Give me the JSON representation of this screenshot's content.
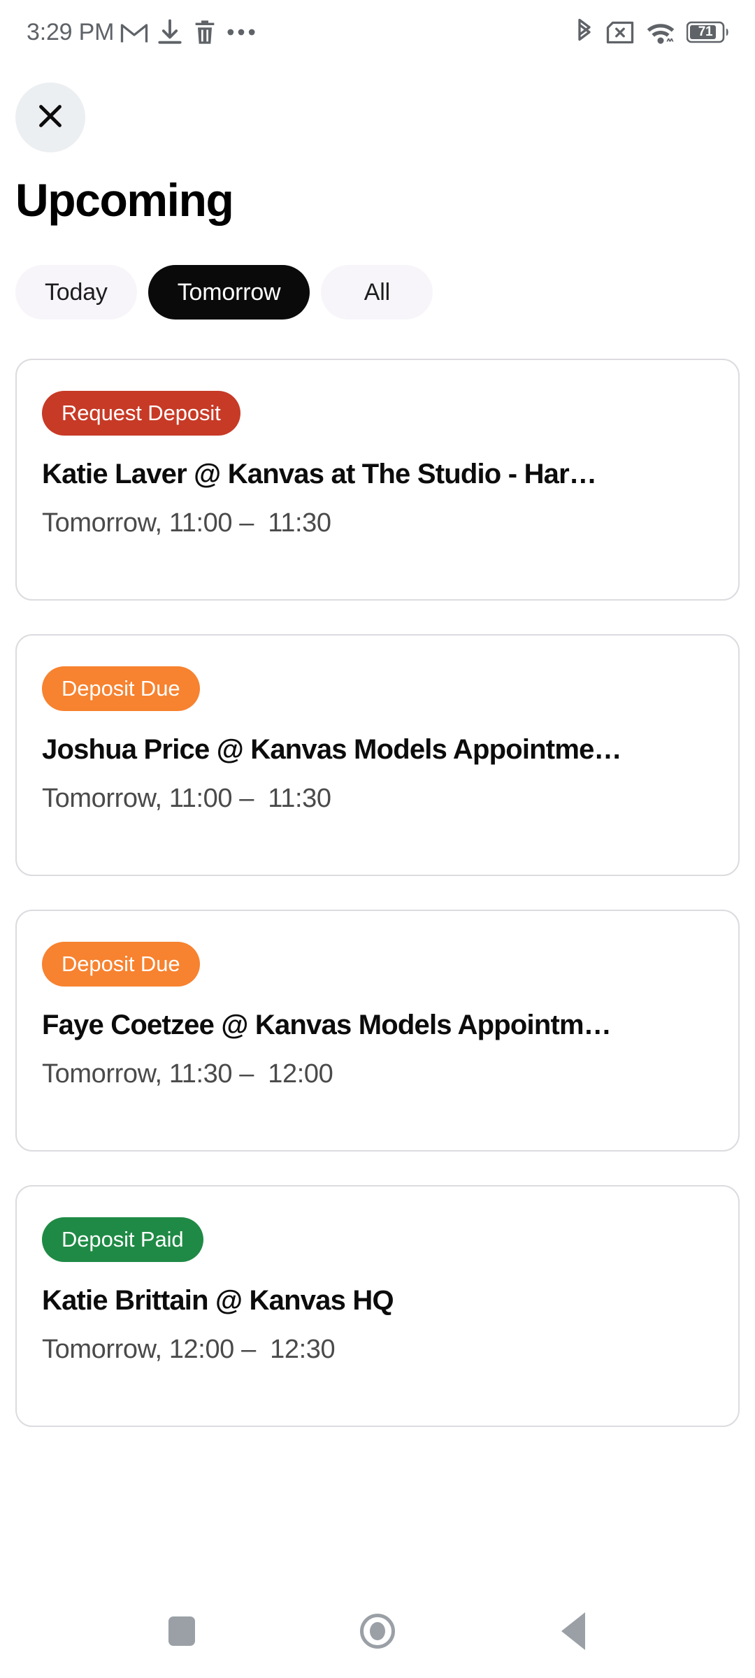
{
  "status_bar": {
    "clock": "3:29 PM",
    "battery_percent": "71",
    "left_icons": [
      "gmail-icon",
      "download-icon",
      "trash-icon",
      "overflow-menu-icon"
    ],
    "right_icons": [
      "bluetooth-icon",
      "sim-card-off-icon",
      "wifi-icon",
      "battery-icon"
    ],
    "icon_color": "#5f6368"
  },
  "header": {
    "close_label": "close-icon",
    "title": "Upcoming"
  },
  "filters": {
    "items": [
      {
        "label": "Today",
        "active": false
      },
      {
        "label": "Tomorrow",
        "active": true
      },
      {
        "label": "All",
        "active": false
      }
    ],
    "active_bg": "#0a0a0a",
    "inactive_bg": "#f7f5f9"
  },
  "colors": {
    "request_deposit": "#c73a26",
    "deposit_due": "#f7822f",
    "deposit_paid": "#1f8a45",
    "card_border": "#dcdbdf",
    "title_text": "#0c0c0c",
    "time_text": "#4a4a4a"
  },
  "appointments": [
    {
      "badge": "Request Deposit",
      "badge_color": "#c73a26",
      "title": "Katie  Laver @ Kanvas at The Studio - Har…",
      "time": "Tomorrow, 11:00 –  11:30"
    },
    {
      "badge": "Deposit Due",
      "badge_color": "#f7822f",
      "title": "Joshua Price @ Kanvas Models Appointme…",
      "time": "Tomorrow, 11:00 –  11:30"
    },
    {
      "badge": "Deposit Due",
      "badge_color": "#f7822f",
      "title": "Faye  Coetzee @ Kanvas Models Appointm…",
      "time": "Tomorrow, 11:30 –  12:00"
    },
    {
      "badge": "Deposit Paid",
      "badge_color": "#1f8a45",
      "title": "Katie Brittain @ Kanvas HQ",
      "time": "Tomorrow, 12:00 –  12:30"
    }
  ],
  "navbar": {
    "recents_label": "recents-button",
    "home_label": "home-button",
    "back_label": "back-button",
    "icon_color": "#9aa0a6"
  }
}
